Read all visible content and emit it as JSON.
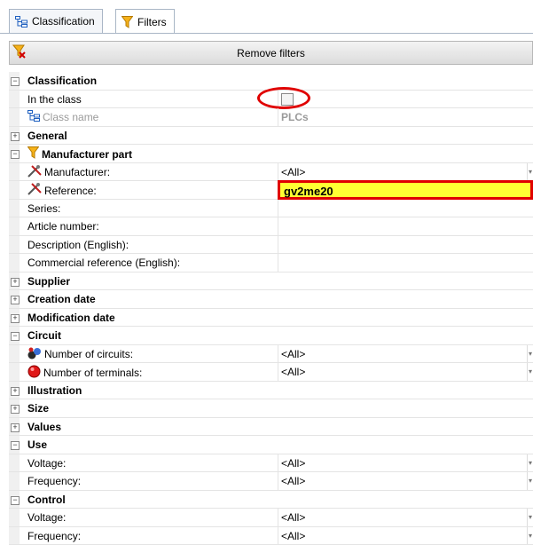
{
  "tabs": [
    {
      "label": "Classification"
    },
    {
      "label": "Filters",
      "active": true
    }
  ],
  "toolbar": {
    "remove_label": "Remove filters"
  },
  "rows": [
    {
      "type": "category",
      "expanded": true,
      "label": "Classification"
    },
    {
      "type": "prop",
      "label": "In the class",
      "value": ""
    },
    {
      "type": "prop",
      "label": "Class name",
      "value": "PLCs"
    },
    {
      "type": "category",
      "expanded": false,
      "label": "General"
    },
    {
      "type": "category",
      "expanded": true,
      "label": "Manufacturer part"
    },
    {
      "type": "prop",
      "label": "Manufacturer:",
      "value": "<All>"
    },
    {
      "type": "prop",
      "label": "Reference:",
      "value": "gv2me20"
    },
    {
      "type": "prop",
      "label": "Series:",
      "value": ""
    },
    {
      "type": "prop",
      "label": "Article number:",
      "value": ""
    },
    {
      "type": "prop",
      "label": "Description (English):",
      "value": ""
    },
    {
      "type": "prop",
      "label": "Commercial reference (English):",
      "value": ""
    },
    {
      "type": "category",
      "expanded": false,
      "label": "Supplier"
    },
    {
      "type": "category",
      "expanded": false,
      "label": "Creation date"
    },
    {
      "type": "category",
      "expanded": false,
      "label": "Modification date"
    },
    {
      "type": "category",
      "expanded": true,
      "label": "Circuit"
    },
    {
      "type": "prop",
      "label": "Number of circuits:",
      "value": "<All>"
    },
    {
      "type": "prop",
      "label": "Number of terminals:",
      "value": "<All>"
    },
    {
      "type": "category",
      "expanded": false,
      "label": "Illustration"
    },
    {
      "type": "category",
      "expanded": false,
      "label": "Size"
    },
    {
      "type": "category",
      "expanded": false,
      "label": "Values"
    },
    {
      "type": "category",
      "expanded": true,
      "label": "Use"
    },
    {
      "type": "prop",
      "label": "Voltage:",
      "value": "<All>"
    },
    {
      "type": "prop",
      "label": "Frequency:",
      "value": "<All>"
    },
    {
      "type": "category",
      "expanded": true,
      "label": "Control"
    },
    {
      "type": "prop",
      "label": "Voltage:",
      "value": "<All>"
    },
    {
      "type": "prop",
      "label": "Frequency:",
      "value": "<All>"
    }
  ],
  "colors": {
    "highlight": "#ffff33",
    "annotation": "#e00000"
  }
}
